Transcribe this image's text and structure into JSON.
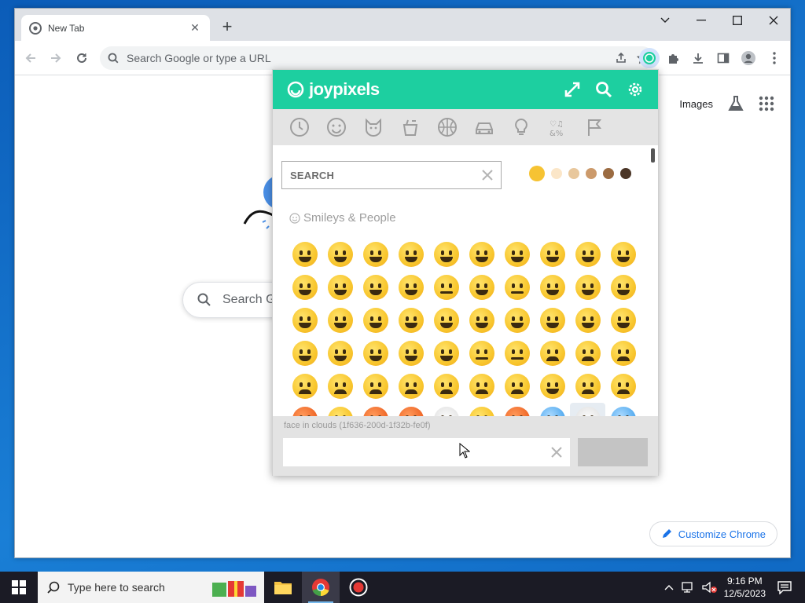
{
  "browser": {
    "tab_title": "New Tab",
    "omnibox_placeholder": "Search Google or type a URL"
  },
  "newtab": {
    "images_link": "Images",
    "search_placeholder": "Search Google or type a URL",
    "search_visible": "Search G",
    "customize_label": "Customize Chrome"
  },
  "popup": {
    "brand": "joypixels",
    "search_placeholder": "SEARCH",
    "section_title": "Smileys & People",
    "preview_label": "face in clouds (1f636-200d-1f32b-fe0f)",
    "tones": [
      "#f6c333",
      "#fbe6c8",
      "#e8c79c",
      "#cc9a6b",
      "#9b6b41",
      "#4a3526"
    ],
    "categories": [
      "recent-icon",
      "smileys-icon",
      "animals-icon",
      "food-icon",
      "activity-icon",
      "travel-icon",
      "objects-icon",
      "symbols-icon",
      "flags-icon"
    ],
    "emoji_rows": [
      [
        "grinning",
        "smiley",
        "smile",
        "grin",
        "laughing",
        "smiling-tear",
        "sweat-smile",
        "joy",
        "rofl",
        "holding-tears"
      ],
      [
        "relaxed",
        "blush",
        "innocent",
        "slight-smile",
        "upside-down",
        "wink",
        "relieved",
        "heart-eyes",
        "hearts-face",
        "kissing-heart"
      ],
      [
        "kissing",
        "kissing-closed-eyes",
        "kissing-smiling-eyes",
        "yum",
        "tongue",
        "squinting-tongue",
        "winking-tongue",
        "zany",
        "raised-eyebrow",
        "monocle"
      ],
      [
        "nerd",
        "sunglasses",
        "disguised",
        "star-struck",
        "partying",
        "smirk",
        "unamused",
        "disappointed",
        "pensive",
        "worried"
      ],
      [
        "confused",
        "slightly-frowning",
        "frowning",
        "persevere",
        "confounded",
        "tired",
        "weary",
        "pleading",
        "cry",
        "sob"
      ],
      [
        "angry",
        "hot",
        "rage",
        "swear",
        "face-in-clouds",
        "hushed",
        "exploding",
        "cold",
        "selected",
        "fearful"
      ]
    ]
  },
  "taskbar": {
    "search_placeholder": "Type here to search",
    "time": "9:16 PM",
    "date": "12/5/2023"
  }
}
